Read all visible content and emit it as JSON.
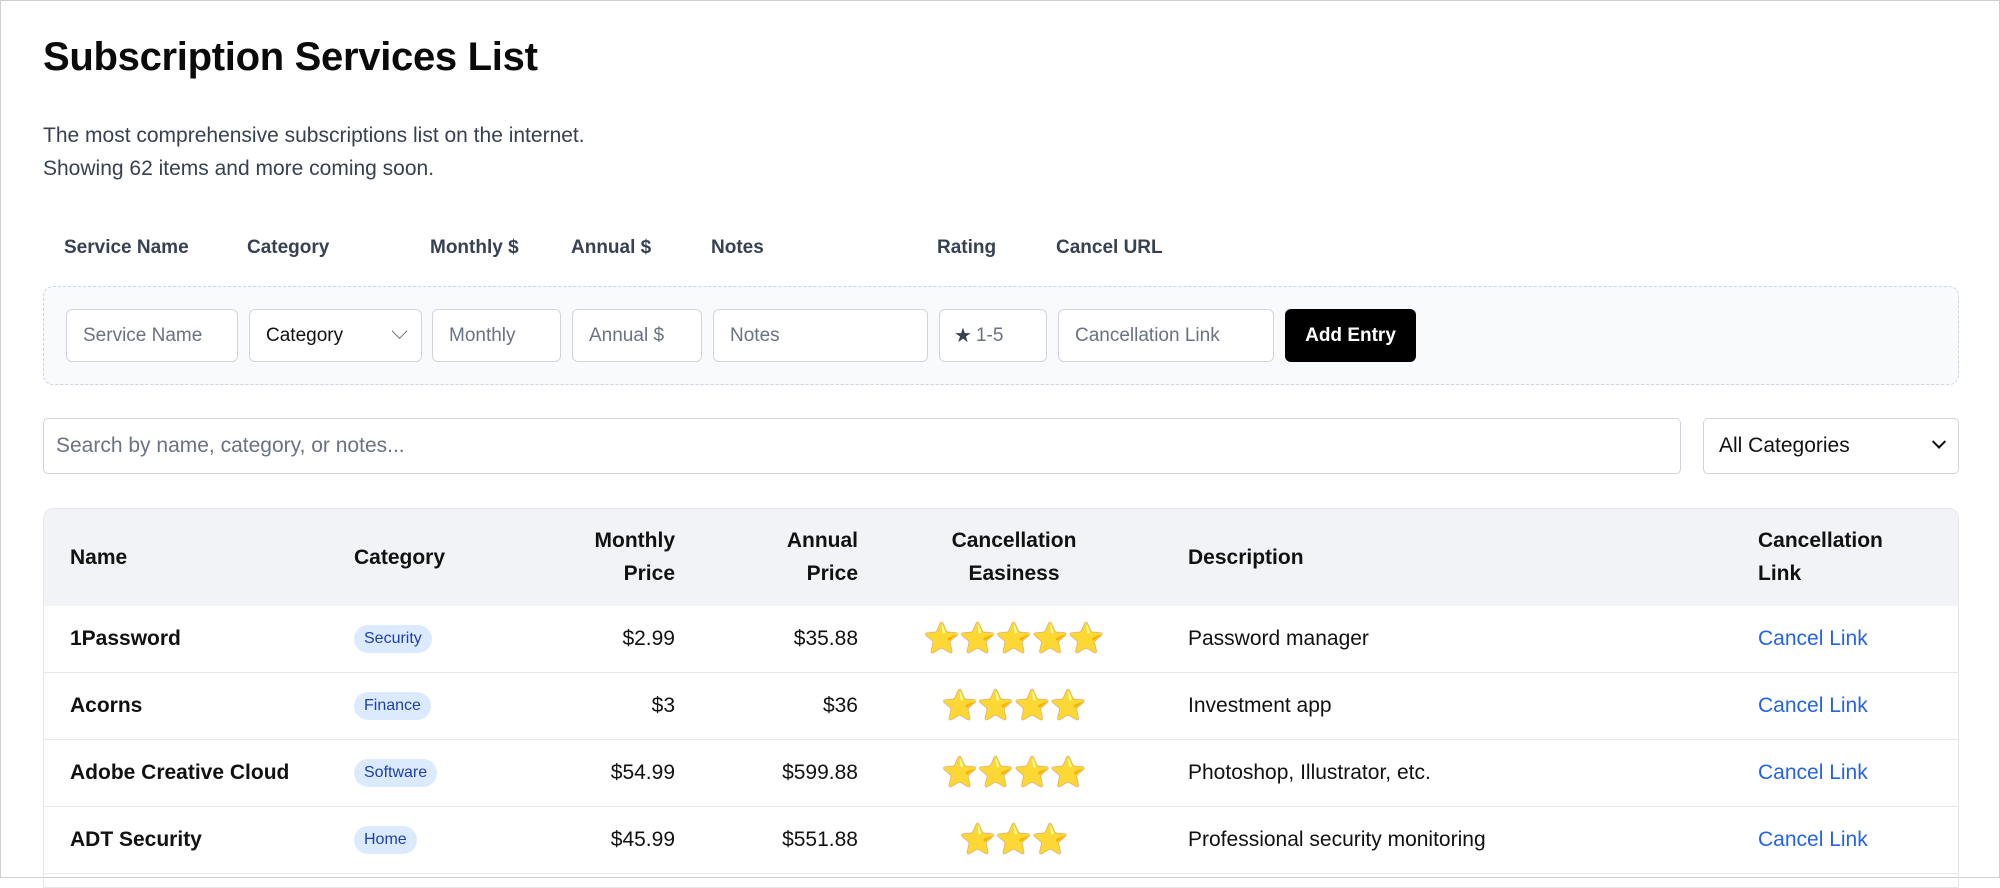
{
  "header": {
    "title": "Subscription Services List",
    "subtitle_line1": "The most comprehensive subscriptions list on the internet.",
    "subtitle_line2": "Showing 62 items and more coming soon."
  },
  "form": {
    "labels": {
      "service_name": "Service Name",
      "category": "Category",
      "monthly": "Monthly $",
      "annual": "Annual $",
      "notes": "Notes",
      "rating": "Rating",
      "cancel_url": "Cancel URL"
    },
    "placeholders": {
      "service_name": "Service Name",
      "monthly": "Monthly",
      "annual": "Annual $",
      "notes": "Notes",
      "cancel_url": "Cancellation Link"
    },
    "category_value": "Category",
    "rating_placeholder": "1-5",
    "rating_icon": "★",
    "add_button": "Add Entry"
  },
  "search": {
    "placeholder": "Search by name, category, or notes...",
    "filter_value": "All Categories"
  },
  "table": {
    "headers": {
      "name": "Name",
      "category": "Category",
      "monthly_line1": "Monthly",
      "monthly_line2": "Price",
      "annual_line1": "Annual",
      "annual_line2": "Price",
      "easiness_line1": "Cancellation",
      "easiness_line2": "Easiness",
      "description": "Description",
      "link_line1": "Cancellation",
      "link_line2": "Link"
    },
    "rows": [
      {
        "name": "1Password",
        "category": "Security",
        "monthly": "$2.99",
        "annual": "$35.88",
        "stars": "⭐⭐⭐⭐⭐",
        "rating": 5,
        "description": "Password manager",
        "link": "Cancel Link"
      },
      {
        "name": "Acorns",
        "category": "Finance",
        "monthly": "$3",
        "annual": "$36",
        "stars": "⭐⭐⭐⭐",
        "rating": 4,
        "description": "Investment app",
        "link": "Cancel Link"
      },
      {
        "name": "Adobe Creative Cloud",
        "category": "Software",
        "monthly": "$54.99",
        "annual": "$599.88",
        "stars": "⭐⭐⭐⭐",
        "rating": 4,
        "description": "Photoshop, Illustrator, etc.",
        "link": "Cancel Link"
      },
      {
        "name": "ADT Security",
        "category": "Home",
        "monthly": "$45.99",
        "annual": "$551.88",
        "stars": "⭐⭐⭐",
        "rating": 3,
        "description": "Professional security monitoring",
        "link": "Cancel Link"
      }
    ]
  },
  "colors": {
    "badge_bg": "#dbeafe",
    "badge_text": "#1e40af",
    "link": "#2563eb",
    "button_bg": "#000000",
    "header_bg": "#f1f3f6",
    "star": "#fbbf24"
  }
}
